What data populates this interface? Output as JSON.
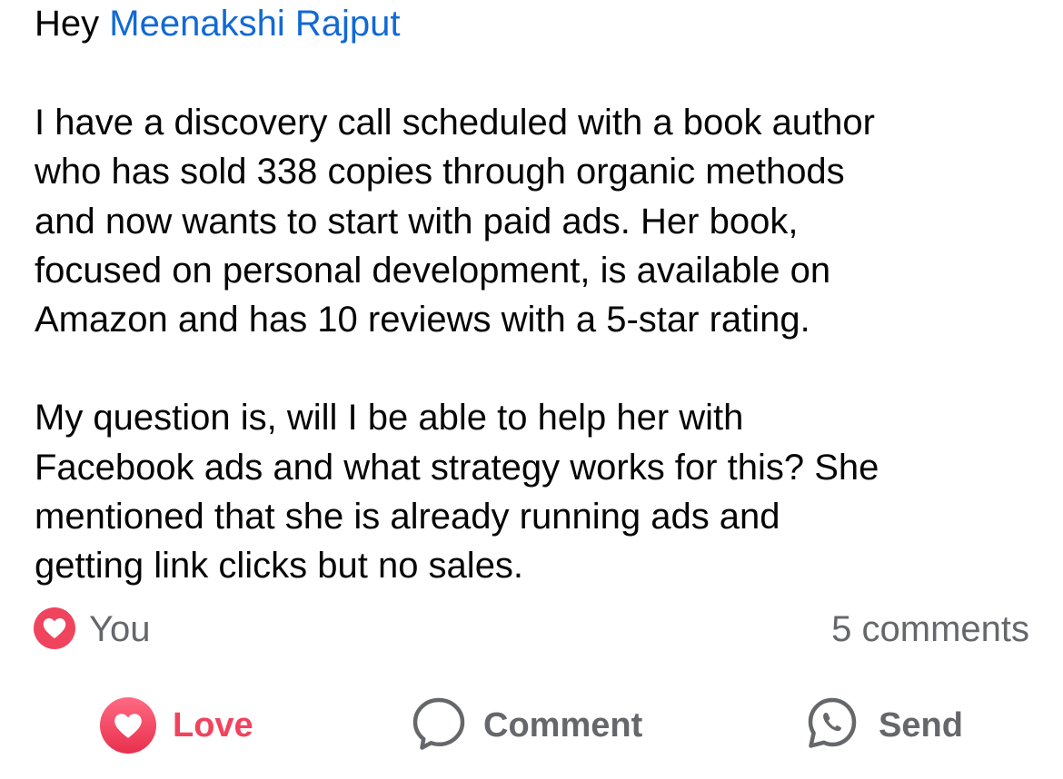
{
  "post": {
    "greeting_prefix": "Hey",
    "mention_name": "Meenakshi Rajput",
    "paragraph_1_lines": [
      "I have a discovery call scheduled with a book author",
      "who has sold 338 copies through organic methods",
      "and now wants to start with paid ads. Her book,",
      "focused on personal development, is available on",
      "Amazon and has 10 reviews with a 5-star rating."
    ],
    "paragraph_2_lines": [
      "My question is, will I be able to help her with",
      "Facebook ads and what strategy works for this? She",
      "mentioned that she is already running ads and",
      "getting link clicks but no sales."
    ]
  },
  "reactions": {
    "icon": "heart-icon",
    "who": "You",
    "comment_count_text": "5 comments"
  },
  "actions": {
    "love": {
      "label": "Love",
      "icon": "heart-icon"
    },
    "comment": {
      "label": "Comment",
      "icon": "comment-bubble-icon"
    },
    "send": {
      "label": "Send",
      "icon": "whatsapp-icon"
    }
  },
  "colors": {
    "mention": "#1169d6",
    "love_accent": "#f0445e",
    "secondary_text": "#65676b",
    "body_text": "#050505"
  }
}
